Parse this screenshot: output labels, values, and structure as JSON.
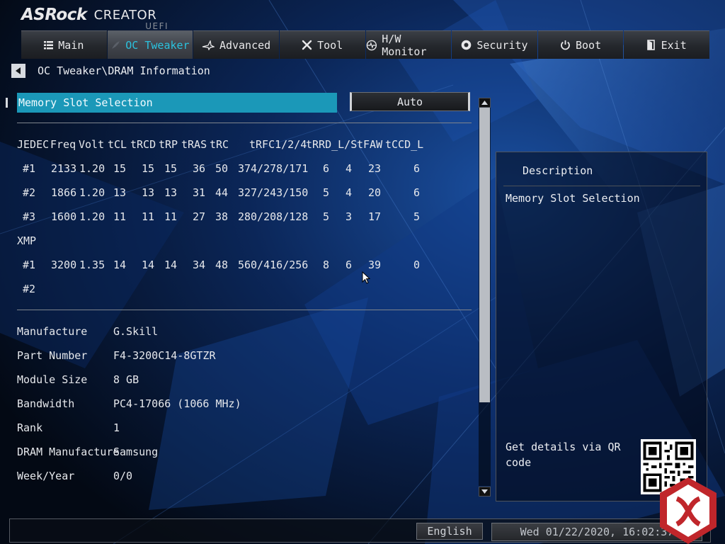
{
  "brand": {
    "name": "ASRock",
    "product": "CREATOR",
    "firmware": "UEFI"
  },
  "tabs": [
    {
      "label": "Main",
      "icon": "list-icon",
      "active": false
    },
    {
      "label": "OC Tweaker",
      "icon": "rocket-icon",
      "active": true
    },
    {
      "label": "Advanced",
      "icon": "star-icon",
      "active": false
    },
    {
      "label": "Tool",
      "icon": "tools-icon",
      "active": false
    },
    {
      "label": "H/W Monitor",
      "icon": "monitor-icon",
      "active": false
    },
    {
      "label": "Security",
      "icon": "shield-icon",
      "active": false
    },
    {
      "label": "Boot",
      "icon": "power-icon",
      "active": false
    },
    {
      "label": "Exit",
      "icon": "exit-icon",
      "active": false
    }
  ],
  "breadcrumb": "OC Tweaker\\DRAM Information",
  "memory_slot": {
    "label": "Memory Slot Selection",
    "value": "Auto"
  },
  "timings": {
    "headers": [
      "JEDEC",
      "Freq",
      "Volt",
      "tCL",
      "tRCD",
      "tRP",
      "tRAS",
      "tRC",
      "tRFC1/2/4",
      "tRRD_L/S",
      "tFAW",
      "tCCD_L"
    ],
    "jedec": [
      {
        "id": "#1",
        "freq": "2133",
        "volt": "1.20",
        "tcl": "15",
        "trcd": "15",
        "trp": "15",
        "tras": "36",
        "trc": "50",
        "trfc": "374/278/171",
        "trrd_l": "6",
        "trrd_s": "4",
        "tfaw": "23",
        "tccd_l": "6"
      },
      {
        "id": "#2",
        "freq": "1866",
        "volt": "1.20",
        "tcl": "13",
        "trcd": "13",
        "trp": "13",
        "tras": "31",
        "trc": "44",
        "trfc": "327/243/150",
        "trrd_l": "5",
        "trrd_s": "4",
        "tfaw": "20",
        "tccd_l": "6"
      },
      {
        "id": "#3",
        "freq": "1600",
        "volt": "1.20",
        "tcl": "11",
        "trcd": "11",
        "trp": "11",
        "tras": "27",
        "trc": "38",
        "trfc": "280/208/128",
        "trrd_l": "5",
        "trrd_s": "3",
        "tfaw": "17",
        "tccd_l": "5"
      }
    ],
    "xmp_label": "XMP",
    "xmp": [
      {
        "id": "#1",
        "freq": "3200",
        "volt": "1.35",
        "tcl": "14",
        "trcd": "14",
        "trp": "14",
        "tras": "34",
        "trc": "48",
        "trfc": "560/416/256",
        "trrd_l": "8",
        "trrd_s": "6",
        "tfaw": "39",
        "tccd_l": "0"
      },
      {
        "id": "#2"
      }
    ]
  },
  "module_info": [
    {
      "label": "Manufacture",
      "value": "G.Skill"
    },
    {
      "label": "Part Number",
      "value": "F4-3200C14-8GTZR"
    },
    {
      "label": "Module Size",
      "value": "8 GB"
    },
    {
      "label": "Bandwidth",
      "value": "PC4-17066 (1066 MHz)"
    },
    {
      "label": "Rank",
      "value": "1"
    },
    {
      "label": "DRAM Manufacture",
      "value": "Samsung"
    },
    {
      "label": "Week/Year",
      "value": "0/0"
    }
  ],
  "description": {
    "title": "Description",
    "text": "Memory Slot Selection",
    "qr_text": "Get details via QR code"
  },
  "footer": {
    "language": "English",
    "datetime": "Wed 01/22/2020, 16:02:37"
  },
  "colors": {
    "accent": "#2bc2de",
    "selection": "#1b98b8",
    "background": "#050c1d"
  }
}
